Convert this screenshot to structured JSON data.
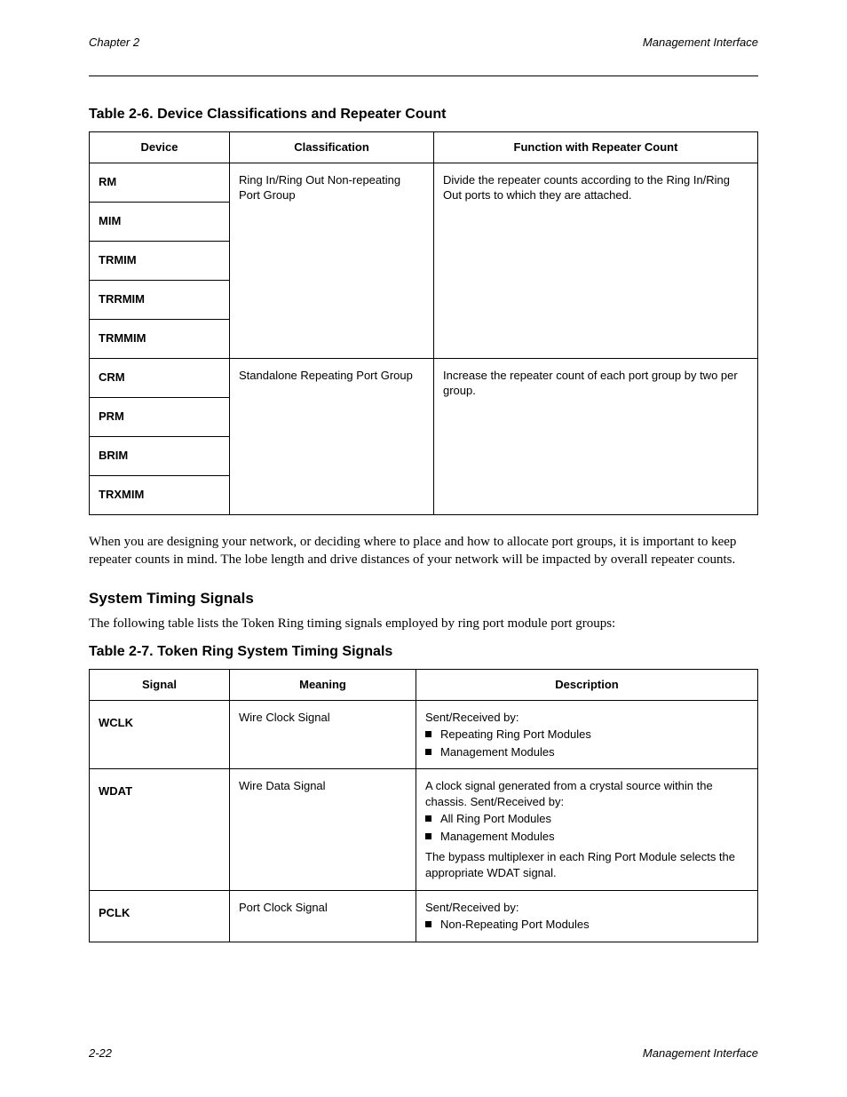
{
  "header": {
    "left": "Chapter 2",
    "right": "Management Interface"
  },
  "table1": {
    "title": "Table 2-6. Device Classifications and Repeater Count",
    "headers": [
      "Device",
      "Classification",
      "Function with Repeater Count"
    ],
    "groups": [
      {
        "devices": [
          "RM",
          "MIM",
          "TRMIM",
          "TRRMIM",
          "TRMMIM"
        ],
        "classification": "Ring In/Ring Out Non-repeating Port Group",
        "function": "Divide the repeater counts according to the Ring In/Ring Out ports to which they are attached."
      },
      {
        "devices": [
          "CRM",
          "PRM",
          "BRIM",
          "TRXMIM"
        ],
        "classification": "Standalone Repeating Port Group",
        "function": "Increase the repeater count of each port group by two per group."
      }
    ],
    "caption": "When you are designing your network, or deciding where to place and how to allocate port groups, it is important to keep repeater counts in mind. The lobe length and drive distances of your network will be impacted by overall repeater counts."
  },
  "signals": {
    "title": "System Timing Signals",
    "intro": "The following table lists the Token Ring timing signals employed by ring port module port groups:",
    "table_title": "Table 2-7. Token Ring System Timing Signals",
    "headers": [
      "Signal",
      "Meaning",
      "Description"
    ],
    "rows": [
      {
        "signal": "WCLK",
        "meaning": "Wire Clock Signal",
        "desc_intro": "Sent/Received by:",
        "bullets": [
          "Repeating Ring Port Modules",
          "Management Modules"
        ],
        "desc_trail": ""
      },
      {
        "signal": "WDAT",
        "meaning": "Wire Data Signal",
        "desc_intro": "A clock signal generated from a crystal source within the chassis. Sent/Received by:",
        "bullets": [
          "All Ring Port Modules",
          "Management Modules"
        ],
        "desc_trail": "The bypass multiplexer in each Ring Port Module selects the appropriate WDAT signal."
      },
      {
        "signal": "PCLK",
        "meaning": "Port Clock Signal",
        "desc_intro": "Sent/Received by:",
        "bullets": [
          "Non-Repeating Port Modules"
        ],
        "desc_trail": ""
      }
    ]
  },
  "footer": {
    "left": "2-22",
    "right": "Management Interface"
  }
}
